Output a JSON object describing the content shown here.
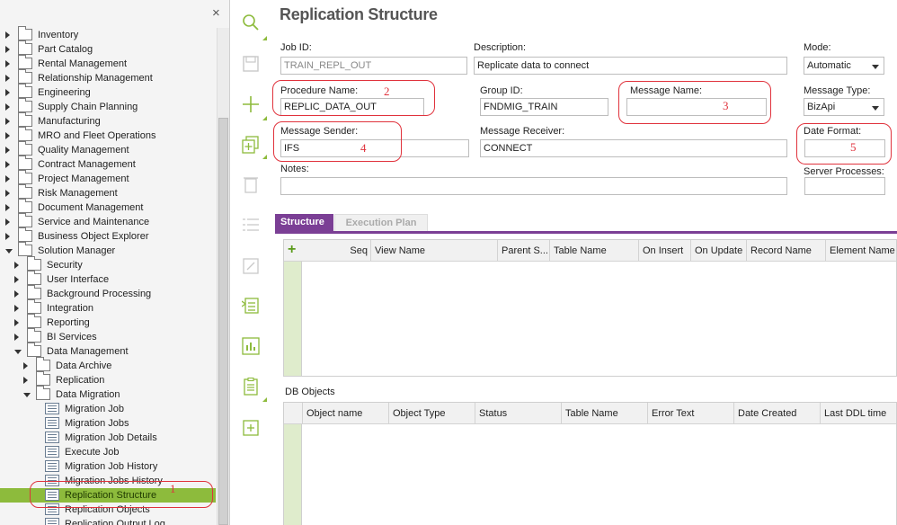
{
  "sidebar": {
    "close_icon": "×",
    "items": [
      {
        "label": "Inventory",
        "level": 0,
        "state": "collapsed",
        "kind": "folder"
      },
      {
        "label": "Part Catalog",
        "level": 0,
        "state": "collapsed",
        "kind": "folder"
      },
      {
        "label": "Rental Management",
        "level": 0,
        "state": "collapsed",
        "kind": "folder"
      },
      {
        "label": "Relationship Management",
        "level": 0,
        "state": "collapsed",
        "kind": "folder"
      },
      {
        "label": "Engineering",
        "level": 0,
        "state": "collapsed",
        "kind": "folder"
      },
      {
        "label": "Supply Chain Planning",
        "level": 0,
        "state": "collapsed",
        "kind": "folder"
      },
      {
        "label": "Manufacturing",
        "level": 0,
        "state": "collapsed",
        "kind": "folder"
      },
      {
        "label": "MRO and Fleet Operations",
        "level": 0,
        "state": "collapsed",
        "kind": "folder"
      },
      {
        "label": "Quality Management",
        "level": 0,
        "state": "collapsed",
        "kind": "folder"
      },
      {
        "label": "Contract Management",
        "level": 0,
        "state": "collapsed",
        "kind": "folder"
      },
      {
        "label": "Project Management",
        "level": 0,
        "state": "collapsed",
        "kind": "folder"
      },
      {
        "label": "Risk Management",
        "level": 0,
        "state": "collapsed",
        "kind": "folder"
      },
      {
        "label": "Document Management",
        "level": 0,
        "state": "collapsed",
        "kind": "folder"
      },
      {
        "label": "Service and Maintenance",
        "level": 0,
        "state": "collapsed",
        "kind": "folder"
      },
      {
        "label": "Business Object Explorer",
        "level": 0,
        "state": "collapsed",
        "kind": "folder"
      },
      {
        "label": "Solution Manager",
        "level": 0,
        "state": "expanded",
        "kind": "folder"
      },
      {
        "label": "Security",
        "level": 1,
        "state": "collapsed",
        "kind": "folder"
      },
      {
        "label": "User Interface",
        "level": 1,
        "state": "collapsed",
        "kind": "folder"
      },
      {
        "label": "Background Processing",
        "level": 1,
        "state": "collapsed",
        "kind": "folder"
      },
      {
        "label": "Integration",
        "level": 1,
        "state": "collapsed",
        "kind": "folder"
      },
      {
        "label": "Reporting",
        "level": 1,
        "state": "collapsed",
        "kind": "folder"
      },
      {
        "label": "BI Services",
        "level": 1,
        "state": "collapsed",
        "kind": "folder"
      },
      {
        "label": "Data Management",
        "level": 1,
        "state": "expanded",
        "kind": "folder"
      },
      {
        "label": "Data Archive",
        "level": 2,
        "state": "collapsed",
        "kind": "folder"
      },
      {
        "label": "Replication",
        "level": 2,
        "state": "collapsed",
        "kind": "folder"
      },
      {
        "label": "Data Migration",
        "level": 2,
        "state": "expanded",
        "kind": "folder"
      },
      {
        "label": "Migration Job",
        "level": 3,
        "state": "none",
        "kind": "page"
      },
      {
        "label": "Migration Jobs",
        "level": 3,
        "state": "none",
        "kind": "page"
      },
      {
        "label": "Migration Job Details",
        "level": 3,
        "state": "none",
        "kind": "page"
      },
      {
        "label": "Execute Job",
        "level": 3,
        "state": "none",
        "kind": "page"
      },
      {
        "label": "Migration Job History",
        "level": 3,
        "state": "none",
        "kind": "page"
      },
      {
        "label": "Migration Jobs History",
        "level": 3,
        "state": "none",
        "kind": "page"
      },
      {
        "label": "Replication Structure",
        "level": 3,
        "state": "none",
        "kind": "page",
        "selected": true
      },
      {
        "label": "Replication Objects",
        "level": 3,
        "state": "none",
        "kind": "page"
      },
      {
        "label": "Replication Output Log",
        "level": 3,
        "state": "none",
        "kind": "page"
      }
    ]
  },
  "toolbar": {
    "icons": [
      "search-icon",
      "save-icon",
      "add-icon",
      "duplicate-icon",
      "delete-icon",
      "list-icon",
      "open-icon",
      "export-list-icon",
      "chart-icon",
      "details-icon",
      "new-record-icon"
    ]
  },
  "main": {
    "title": "Replication Structure",
    "fields": {
      "job_id": {
        "label": "Job ID:",
        "value": "TRAIN_REPL_OUT"
      },
      "description": {
        "label": "Description:",
        "value": "Replicate data to connect"
      },
      "mode": {
        "label": "Mode:",
        "value": "Automatic"
      },
      "procedure_name": {
        "label": "Procedure Name:",
        "value": "REPLIC_DATA_OUT"
      },
      "group_id": {
        "label": "Group ID:",
        "value": "FNDMIG_TRAIN"
      },
      "message_name": {
        "label": "Message Name:",
        "value": ""
      },
      "message_type": {
        "label": "Message Type:",
        "value": "BizApi"
      },
      "message_sender": {
        "label": "Message Sender:",
        "value": "IFS"
      },
      "message_receiver": {
        "label": "Message Receiver:",
        "value": "CONNECT"
      },
      "date_format": {
        "label": "Date Format:",
        "value": ""
      },
      "notes": {
        "label": "Notes:",
        "value": ""
      },
      "server_processes": {
        "label": "Server Processes:",
        "value": ""
      }
    },
    "annotations": [
      "1",
      "2",
      "3",
      "4",
      "5"
    ],
    "tabs": [
      "Structure",
      "Execution Plan"
    ],
    "structure_grid": {
      "add_icon": "+",
      "columns": [
        "Seq",
        "View Name",
        "Parent S...",
        "Table Name",
        "On Insert",
        "On Update",
        "Record Name",
        "Element Name"
      ]
    },
    "db_objects": {
      "label": "DB Objects",
      "columns": [
        "Object name",
        "Object Type",
        "Status",
        "Table Name",
        "Error Text",
        "Date Created",
        "Last DDL time"
      ]
    }
  },
  "colors": {
    "accent_green": "#8dbb3c",
    "tab_purple": "#7b3f95",
    "annotation_red": "#e0323c"
  }
}
